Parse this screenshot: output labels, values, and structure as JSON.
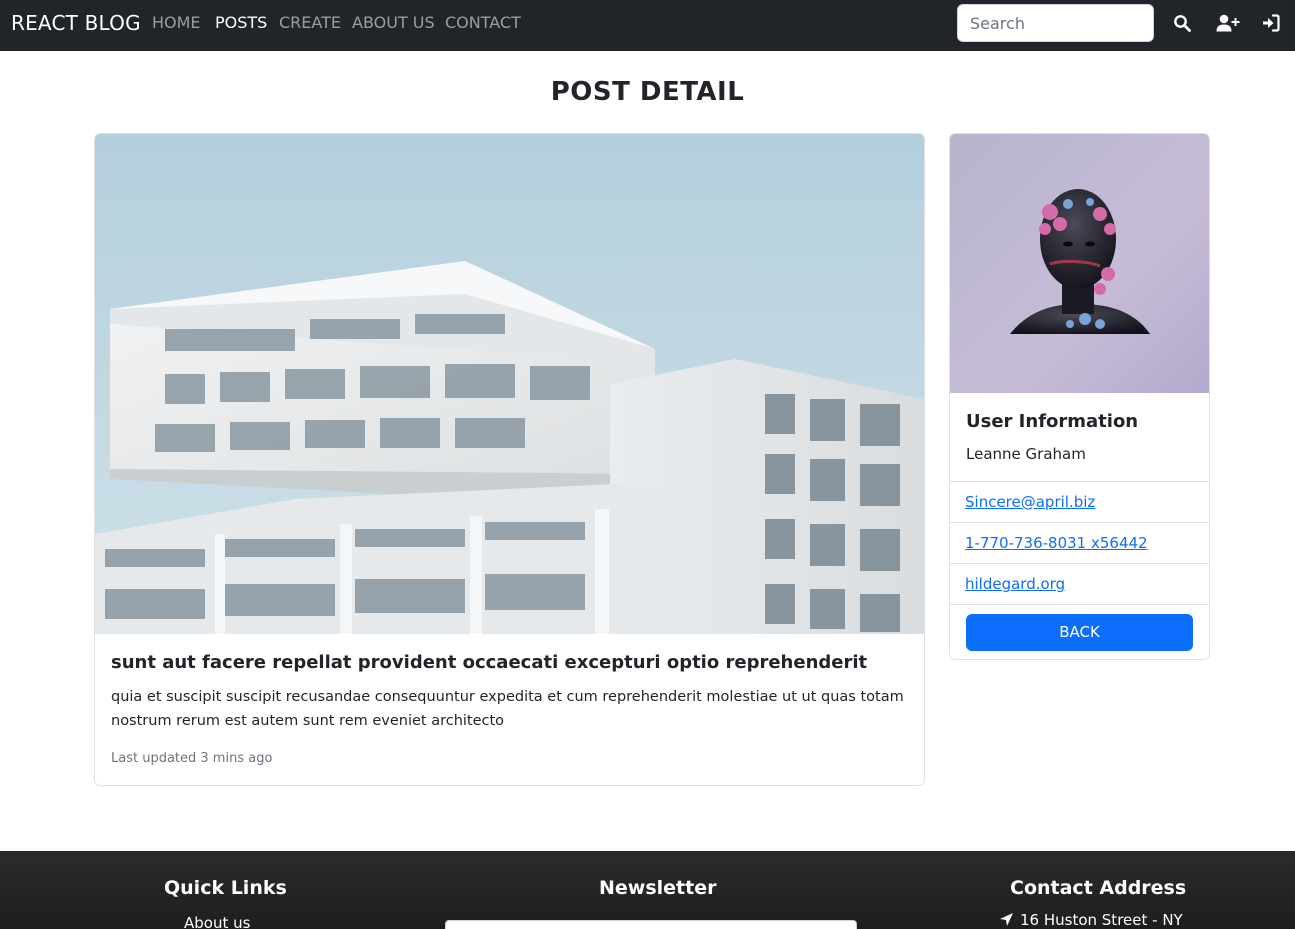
{
  "nav": {
    "brand": "REACT BLOG",
    "links": [
      {
        "label": "HOME",
        "active": false
      },
      {
        "label": "POSTS",
        "active": true
      },
      {
        "label": "CREATE",
        "active": false
      },
      {
        "label": "ABOUT US",
        "active": false
      },
      {
        "label": "CONTACT",
        "active": false
      }
    ],
    "search_placeholder": "Search",
    "icons": [
      "search-icon",
      "user-plus-icon",
      "sign-in-icon"
    ]
  },
  "page": {
    "title": "POST DETAIL"
  },
  "post": {
    "image_alt": "white modern apartment building against pale blue sky",
    "title": "sunt aut facere repellat provident occaecati excepturi optio reprehenderit",
    "body": "quia et suscipit suscipit recusandae consequuntur expedita et cum reprehenderit molestiae ut ut quas totam nostrum rerum est autem sunt rem eveniet architecto",
    "updated": "Last updated 3 mins ago"
  },
  "user": {
    "image_alt": "sculpted head with flowers on lavender background",
    "heading": "User Information",
    "name": "Leanne Graham",
    "email": "Sincere@april.biz",
    "phone": "1-770-736-8031 x56442",
    "website": "hildegard.org",
    "back_label": "BACK"
  },
  "footer": {
    "quick_links_heading": "Quick Links",
    "quick_links": [
      "About us"
    ],
    "newsletter_heading": "Newsletter",
    "contact_heading": "Contact Address",
    "address_line": "16 Huston Street - NY"
  },
  "colors": {
    "navbar_bg": "#212529",
    "primary": "#0d6efd",
    "footer_bg": "#252525"
  }
}
